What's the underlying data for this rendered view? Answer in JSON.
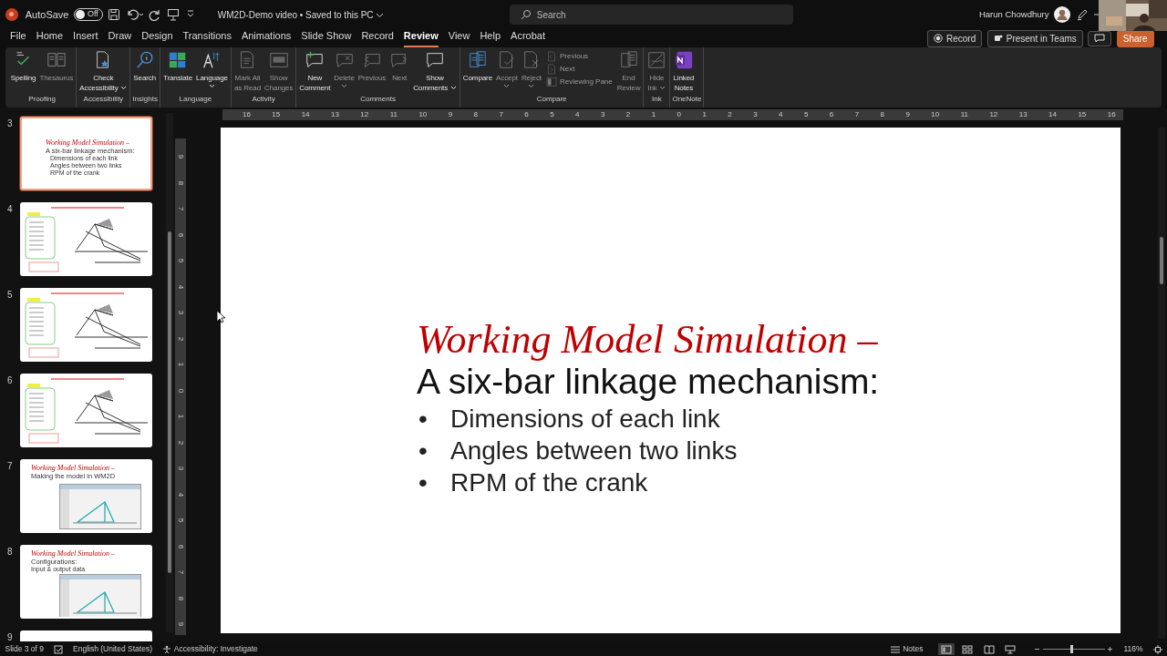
{
  "title_bar": {
    "autosave_label": "AutoSave",
    "autosave_on": false,
    "autosave_state": "Off",
    "document_title": "WM2D-Demo video • Saved to this PC",
    "search_placeholder": "Search",
    "user_name": "Harun Chowdhury"
  },
  "menu_tabs": [
    {
      "label": "File",
      "selected": false
    },
    {
      "label": "Home",
      "selected": false
    },
    {
      "label": "Insert",
      "selected": false
    },
    {
      "label": "Draw",
      "selected": false
    },
    {
      "label": "Design",
      "selected": false
    },
    {
      "label": "Transitions",
      "selected": false
    },
    {
      "label": "Animations",
      "selected": false
    },
    {
      "label": "Slide Show",
      "selected": false
    },
    {
      "label": "Record",
      "selected": false
    },
    {
      "label": "Review",
      "selected": true
    },
    {
      "label": "View",
      "selected": false
    },
    {
      "label": "Help",
      "selected": false
    },
    {
      "label": "Acrobat",
      "selected": false
    }
  ],
  "header_buttons": [
    {
      "kind": "record",
      "label": "Record"
    },
    {
      "kind": "teams",
      "label": "Present in Teams"
    },
    {
      "kind": "comments"
    },
    {
      "kind": "share",
      "label": "Share"
    }
  ],
  "ribbon_groups": [
    {
      "label": "Proofing",
      "buttons": [
        {
          "kind": "large",
          "lines": [
            "Spelling"
          ],
          "disabled": false
        },
        {
          "kind": "large",
          "lines": [
            "Thesaurus"
          ],
          "disabled": true
        }
      ]
    },
    {
      "label": "Accessibility",
      "buttons": [
        {
          "kind": "large",
          "lines": [
            "Check",
            "Accessibility"
          ],
          "dropdown": true,
          "disabled": false
        }
      ]
    },
    {
      "label": "Insights",
      "buttons": [
        {
          "kind": "large",
          "lines": [
            "Search"
          ],
          "disabled": false
        }
      ]
    },
    {
      "label": "Language",
      "buttons": [
        {
          "kind": "large",
          "lines": [
            "Translate"
          ],
          "disabled": false
        },
        {
          "kind": "large",
          "lines": [
            "Language"
          ],
          "dropdown": true,
          "disabled": false
        }
      ]
    },
    {
      "label": "Activity",
      "buttons": [
        {
          "kind": "large",
          "lines": [
            "Mark All",
            "as Read"
          ],
          "disabled": true
        },
        {
          "kind": "large",
          "lines": [
            "Show",
            "Changes"
          ],
          "disabled": true
        }
      ]
    },
    {
      "label": "Comments",
      "buttons": [
        {
          "kind": "large",
          "lines": [
            "New",
            "Comment"
          ],
          "disabled": false
        },
        {
          "kind": "large",
          "lines": [
            "Delete"
          ],
          "dropdown": true,
          "disabled": true
        },
        {
          "kind": "large",
          "lines": [
            "Previous"
          ],
          "disabled": true
        },
        {
          "kind": "large",
          "lines": [
            "Next"
          ],
          "disabled": true
        },
        {
          "kind": "large",
          "lines": [
            "Show",
            "Comments"
          ],
          "dropdown": true,
          "disabled": false
        }
      ]
    },
    {
      "label": "Compare",
      "buttons": [
        {
          "kind": "large",
          "lines": [
            "Compare"
          ],
          "disabled": false
        },
        {
          "kind": "large",
          "lines": [
            "Accept"
          ],
          "dropdown": true,
          "disabled": true
        },
        {
          "kind": "large",
          "lines": [
            "Reject"
          ],
          "dropdown": true,
          "disabled": true
        },
        {
          "kind": "small",
          "lines": [
            "Previous"
          ],
          "disabled": true
        },
        {
          "kind": "small",
          "lines": [
            "Next"
          ],
          "disabled": true
        },
        {
          "kind": "small",
          "lines": [
            "Reviewing Pane"
          ],
          "disabled": true
        },
        {
          "kind": "large",
          "lines": [
            "End",
            "Review"
          ],
          "disabled": true
        }
      ]
    },
    {
      "label": "Ink",
      "buttons": [
        {
          "kind": "large",
          "lines": [
            "Hide",
            "Ink"
          ],
          "dropdown": true,
          "disabled": true
        }
      ]
    },
    {
      "label": "OneNote",
      "buttons": [
        {
          "kind": "large",
          "lines": [
            "Linked",
            "Notes"
          ],
          "disabled": false
        }
      ]
    }
  ],
  "thumbnails": [
    {
      "number": "3",
      "selected": true,
      "kind": "text",
      "title": "Working Model Simulation –",
      "subtitle": "A six-bar linkage mechanism:",
      "bullets": [
        "Dimensions of each link",
        "Angles between two links",
        "RPM of the crank"
      ]
    },
    {
      "number": "4",
      "selected": false,
      "kind": "diagram"
    },
    {
      "number": "5",
      "selected": false,
      "kind": "diagram"
    },
    {
      "number": "6",
      "selected": false,
      "kind": "diagram"
    },
    {
      "number": "7",
      "selected": false,
      "kind": "screenshot",
      "title": "Working Model Simulation –",
      "subtitle": "Making the model in WM2D"
    },
    {
      "number": "8",
      "selected": false,
      "kind": "screenshot",
      "title": "Working Model Simulation –",
      "subtitle": "Configurations:",
      "bullets": [
        "Input & output data"
      ]
    },
    {
      "number": "9",
      "selected": false,
      "kind": "partial"
    }
  ],
  "horizontal_ruler": [
    "16",
    "15",
    "14",
    "13",
    "12",
    "11",
    "10",
    "9",
    "8",
    "7",
    "6",
    "5",
    "4",
    "3",
    "2",
    "1",
    "0",
    "1",
    "2",
    "3",
    "4",
    "5",
    "6",
    "7",
    "8",
    "9",
    "10",
    "11",
    "12",
    "13",
    "14",
    "15",
    "16"
  ],
  "vertical_ruler": [
    "9",
    "8",
    "7",
    "6",
    "5",
    "4",
    "3",
    "2",
    "1",
    "0",
    "1",
    "2",
    "3",
    "4",
    "5",
    "6",
    "7",
    "8",
    "9"
  ],
  "slide": {
    "title": "Working Model Simulation –",
    "subtitle": "A six-bar linkage mechanism:",
    "bullets": [
      {
        "mark": "•",
        "text": "Dimensions of each link"
      },
      {
        "mark": "•",
        "text": "Angles between two links"
      },
      {
        "mark": "•",
        "text": "RPM of the crank"
      }
    ]
  },
  "status_bar": {
    "slide_info": "Slide 3 of 9",
    "language": "English (United States)",
    "accessibility": "Accessibility: Investigate",
    "notes": "Notes",
    "views": [
      {
        "selected": true
      },
      {
        "selected": false
      },
      {
        "selected": false
      },
      {
        "selected": false
      }
    ],
    "zoom": {
      "level": 0.45
    },
    "zoom_label": "116%"
  }
}
